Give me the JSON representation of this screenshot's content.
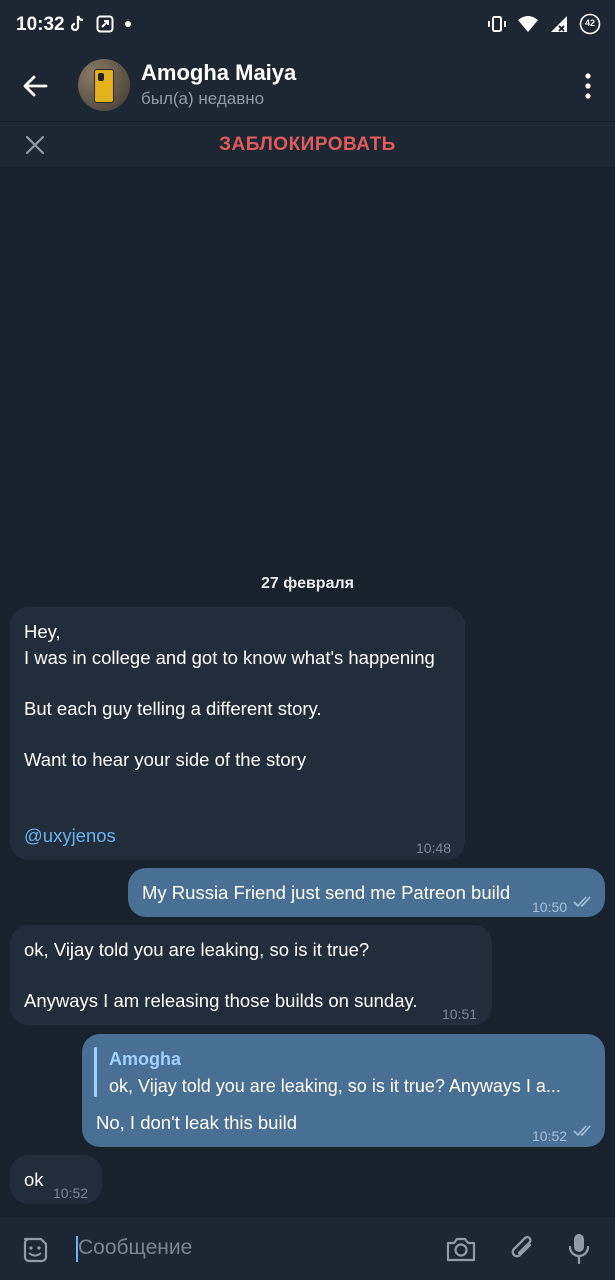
{
  "status_bar": {
    "time": "10:32",
    "battery": "42"
  },
  "header": {
    "contact_name": "Amogha Maiya",
    "contact_status": "был(а) недавно"
  },
  "block_bar": {
    "block_label": "ЗАБЛОКИРОВАТЬ"
  },
  "chat": {
    "date_label": "27 февраля",
    "messages": [
      {
        "direction": "in",
        "lines": [
          "Hey,",
          "I was in college and got to know what's happening",
          "",
          "But each guy telling a different story.",
          "",
          "Want to hear your side of the story",
          "",
          ""
        ],
        "mention": "@uxyjenos",
        "time": "10:48"
      },
      {
        "direction": "out",
        "text": "My Russia Friend just send me Patreon build",
        "time": "10:50"
      },
      {
        "direction": "in",
        "line1": "ok, Vijay told you are leaking, so is it true?",
        "line2": "Anyways I am releasing those builds on sunday.",
        "time": "10:51"
      },
      {
        "direction": "out",
        "reply_author": "Amogha",
        "reply_text": "ok, Vijay told you are leaking, so is it true? Anyways I a...",
        "text": "No, I don't leak this build",
        "time": "10:52"
      },
      {
        "direction": "in",
        "text": "ok",
        "time": "10:52"
      }
    ]
  },
  "input": {
    "placeholder": "Сообщение"
  },
  "colors": {
    "background": "#18222d",
    "bar": "#1d2733",
    "incoming_bubble": "#212d3b",
    "outgoing_bubble": "#4a6f95",
    "accent": "#6ab3f3",
    "danger": "#e05a5a"
  }
}
